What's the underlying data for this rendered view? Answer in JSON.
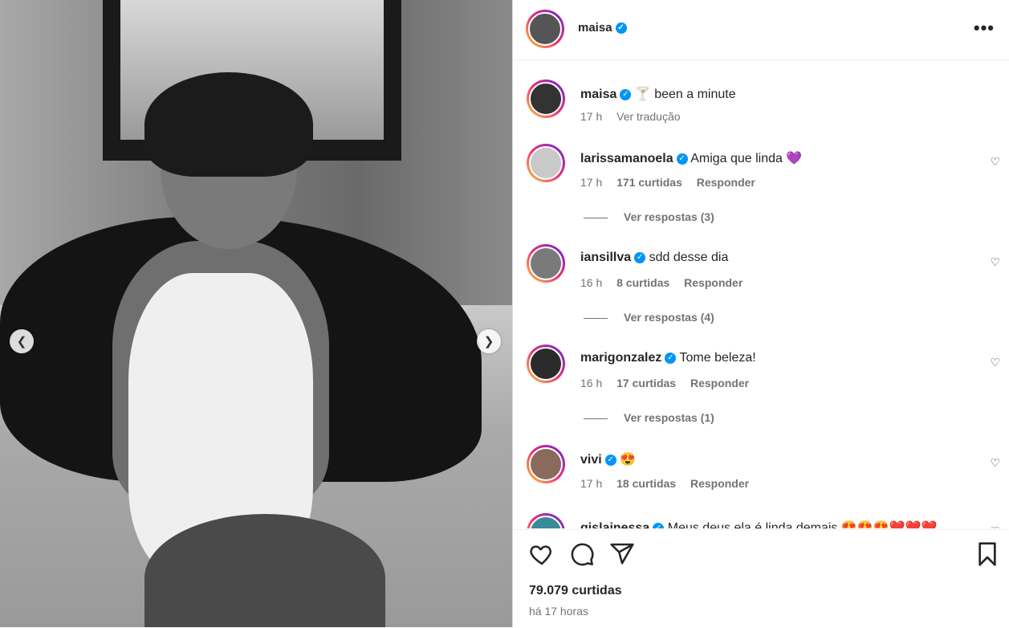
{
  "post": {
    "author": "maisa",
    "more_icon": "more-horizontal-icon",
    "caption": {
      "username": "maisa",
      "text": "🍸 been a minute",
      "time": "17 h",
      "translate": "Ver tradução"
    },
    "comments": [
      {
        "username": "larissamanoela",
        "text": "Amiga que linda 💜",
        "time": "17 h",
        "likes": "171 curtidas",
        "reply": "Responder",
        "view_replies": "Ver respostas (3)"
      },
      {
        "username": "iansillva",
        "text": "sdd desse dia",
        "time": "16 h",
        "likes": "8 curtidas",
        "reply": "Responder",
        "view_replies": "Ver respostas (4)"
      },
      {
        "username": "marigonzalez",
        "text": "Tome beleza!",
        "time": "16 h",
        "likes": "17 curtidas",
        "reply": "Responder",
        "view_replies": "Ver respostas (1)"
      },
      {
        "username": "vivi",
        "text": "😍",
        "time": "17 h",
        "likes": "18 curtidas",
        "reply": "Responder"
      },
      {
        "username": "gislainessa",
        "text": "Meus deus ela é linda demais 😍😍😍❤️❤️❤️"
      }
    ],
    "likes_total": "79.079 curtidas",
    "posted_ago": "há 17 horas"
  },
  "colors": {
    "verified": "#0095f6",
    "secondary_text": "#737373",
    "story_ring": [
      "#f9ce34",
      "#ee2a7b",
      "#6228d7"
    ]
  }
}
